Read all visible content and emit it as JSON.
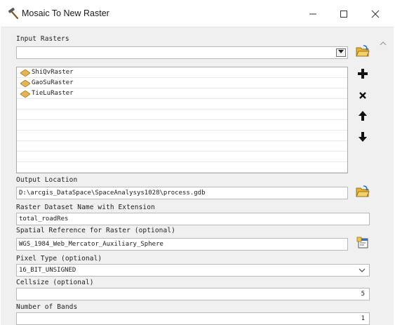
{
  "window": {
    "title": "Mosaic To New Raster",
    "app_icon": "hammer-icon",
    "controls": [
      "minimize-icon",
      "maximize-icon",
      "close-icon"
    ]
  },
  "input_rasters": {
    "label": "Input Rasters",
    "combo_value": "",
    "items": [
      "ShiQvRaster",
      "GaoSuRaster",
      "TieLuRaster"
    ],
    "item_icon": "raster-layer-icon",
    "browse_icon": "open-folder-icon",
    "actions": {
      "add_icon": "plus-icon",
      "remove_icon": "x-icon",
      "up_icon": "arrow-up-icon",
      "down_icon": "arrow-down-icon"
    }
  },
  "output_location": {
    "label": "Output Location",
    "value": "D:\\arcgis_DataSpace\\SpaceAnalysys1028\\process.gdb",
    "browse_icon": "open-folder-icon"
  },
  "raster_dataset_name": {
    "label": "Raster Dataset Name with Extension",
    "value": "total_roadRes"
  },
  "spatial_reference": {
    "label": "Spatial Reference for Raster (optional)",
    "value": "WGS_1984_Web_Mercator_Auxiliary_Sphere",
    "properties_icon": "properties-icon"
  },
  "pixel_type": {
    "label": "Pixel Type (optional)",
    "value": "16_BIT_UNSIGNED"
  },
  "cellsize": {
    "label": "Cellsize (optional)",
    "value": "5"
  },
  "number_of_bands": {
    "label": "Number of Bands",
    "value": "1"
  },
  "colors": {
    "accent_folder": "#e7b532",
    "raster_icon": "#e6b457",
    "field_border": "#b9b9b9",
    "dialog_bg": "#f0f0f0"
  }
}
